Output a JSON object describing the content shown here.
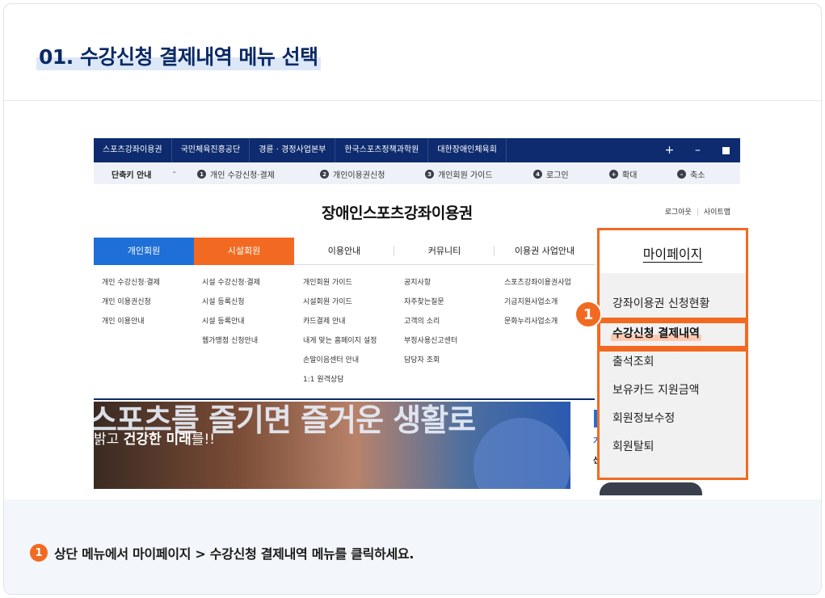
{
  "step": {
    "title": "01. 수강신청 결제내역 메뉴 선택"
  },
  "screenshot": {
    "topbar": {
      "links": [
        "스포츠강좌이용권",
        "국민체육진흥공단",
        "경륜 · 경정사업본부",
        "한국스포츠정책과학원",
        "대한장애인체육회"
      ],
      "controls": [
        "+",
        "–"
      ]
    },
    "shortcut": {
      "label": "단축키 안내",
      "dash": "-",
      "items": [
        {
          "key": "1",
          "label": "개인 수강신청·결제"
        },
        {
          "key": "2",
          "label": "개인이용권신청"
        },
        {
          "key": "3",
          "label": "개인회원 가이드"
        },
        {
          "key": "4",
          "label": "로그인"
        },
        {
          "key": "+",
          "label": "확대"
        },
        {
          "key": "–",
          "label": "축소"
        }
      ]
    },
    "site_title": "장애인스포츠강좌이용권",
    "util": {
      "logout": "로그아웃",
      "sep": "|",
      "sitemap": "사이트맵"
    },
    "gnb": [
      "개인회원",
      "시설회원",
      "이용안내",
      "커뮤니티",
      "이용권 사업안내"
    ],
    "dropdown": [
      [
        "개인 수강신청·결제",
        "개인 이용권신청",
        "개인 이용안내"
      ],
      [
        "시설 수강신청·결제",
        "시설 등록신청",
        "시설 등록안내",
        "웹가맹점 신청안내"
      ],
      [
        "개인회원 가이드",
        "시설회원 가이드",
        "카드결제 안내",
        "내게 맞는 홈페이지 설정",
        "손말이음센터 안내",
        "1:1 원격상담"
      ],
      [
        "공지사항",
        "자주찾는질문",
        "고객의 소리",
        "부정사용신고센터",
        "담당자 조회"
      ],
      [
        "스포츠강좌이용권사업",
        "기금지원사업소개",
        "문화누리사업소개"
      ]
    ],
    "hero": {
      "big_text": "스포츠를 즐기면 즐거운 생활로",
      "sub_prefix": "밝고 ",
      "sub_bold": "건강한 미래",
      "sub_suffix": "를!!"
    },
    "side_peek": {
      "t1": "가",
      "t2": "신"
    }
  },
  "mypage": {
    "title": "마이페이지",
    "items": [
      "강좌이용권 신청현황",
      "수강신청 결제내역",
      "출석조회",
      "보유카드 지원금액",
      "회원정보수정",
      "회원탈퇴"
    ],
    "active_index": 1
  },
  "callout_number": "1",
  "instruction": {
    "number": "1",
    "text": "상단 메뉴에서 마이페이지 > 수강신청 결제내역 메뉴를 클릭하세요."
  },
  "colors": {
    "navy": "#0d2b6e",
    "accent_orange": "#f26a21",
    "accent_blue": "#1f6fd8"
  }
}
